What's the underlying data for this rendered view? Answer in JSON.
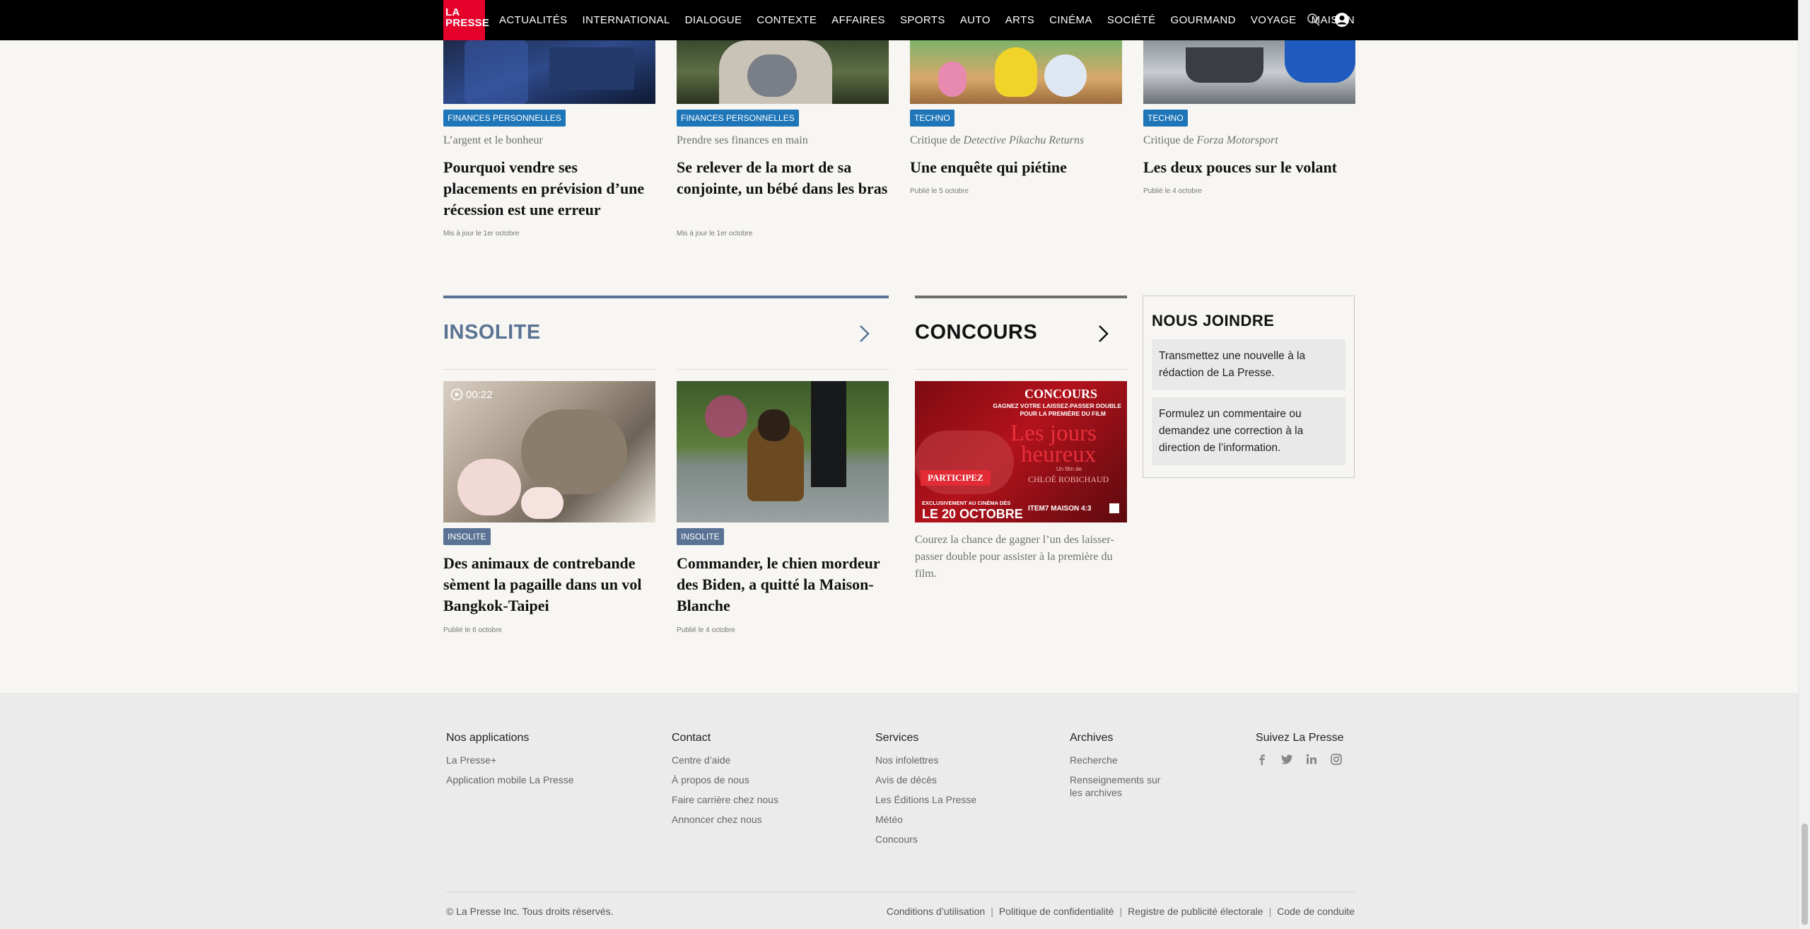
{
  "logo": {
    "line1": "LA",
    "line2": "PRESSE"
  },
  "nav": [
    "ACTUALITÉS",
    "INTERNATIONAL",
    "DIALOGUE",
    "CONTEXTE",
    "AFFAIRES",
    "SPORTS",
    "AUTO",
    "ARTS",
    "CINÉMA",
    "SOCIÉTÉ",
    "GOURMAND",
    "VOYAGE",
    "MAISON"
  ],
  "top_cards": [
    {
      "tag": "FINANCES PERSONNELLES",
      "kicker": "L’argent et le bonheur",
      "headline": "Pourquoi vendre ses placements en prévision d’une récession est une erreur",
      "date": "Mis à jour le 1er octobre"
    },
    {
      "tag": "FINANCES PERSONNELLES",
      "kicker": "Prendre ses finances en main",
      "headline": "Se relever de la mort de sa conjointe, un bébé dans les bras",
      "date": "Mis à jour le 1er octobre"
    },
    {
      "tag": "TECHNO",
      "kicker_prefix": "Critique de ",
      "kicker_italic": "Detective Pikachu Returns",
      "headline": "Une enquête qui piétine",
      "date": "Publié le 5 octobre"
    },
    {
      "tag": "TECHNO",
      "kicker_prefix": "Critique de ",
      "kicker_italic": "Forza Motorsport",
      "headline": "Les deux pouces sur le volant",
      "date": "Publié le 4 octobre"
    }
  ],
  "insolite": {
    "title": "INSOLITE",
    "cards": [
      {
        "video_duration": "00:22",
        "tag": "INSOLITE",
        "headline": "Des animaux de contrebande sèment la pagaille dans un vol Bangkok-Taipei",
        "date": "Publié le 6 octobre"
      },
      {
        "tag": "INSOLITE",
        "headline": "Commander, le chien mordeur des Biden, a quitté la Maison-Blanche",
        "date": "Publié le 4 octobre"
      }
    ]
  },
  "concours": {
    "title": "CONCOURS",
    "banner": {
      "heading": "CONCOURS",
      "sub1": "GAGNEZ VOTRE LAISSEZ-PASSER DOUBLE",
      "sub2": "POUR LA PREMIÈRE DU FILM",
      "film_line1": "Les jours",
      "film_line2": "heureux",
      "director_small": "Un film de",
      "director": "CHLOÉ ROBICHAUD",
      "cta": "PARTICIPEZ",
      "excl": "EXCLUSIVEMENT AU CINÉMA DÈS",
      "date": "LE 20 OCTOBRE",
      "logos": "ITEM7   MAISON 4:3"
    },
    "description": "Courez la chance de gagner l’un des laisser-passer double pour assister à la première du film."
  },
  "joindre": {
    "title": "NOUS JOINDRE",
    "box1": "Transmettez une nouvelle à la rédaction de La Presse.",
    "box2": "Formulez un commentaire ou demandez une correction à la direction de l’information."
  },
  "footer": {
    "apps": {
      "title": "Nos applications",
      "links": [
        "La Presse+",
        "Application mobile La Presse"
      ]
    },
    "contact": {
      "title": "Contact",
      "links": [
        "Centre d’aide",
        "À propos de nous",
        "Faire carrière chez nous",
        "Annoncer chez nous"
      ]
    },
    "services": {
      "title": "Services",
      "links": [
        "Nos infolettres",
        "Avis de décès",
        "Les Éditions La Presse",
        "Météo",
        "Concours"
      ]
    },
    "archives": {
      "title": "Archives",
      "links": [
        "Recherche",
        "Renseignements sur",
        "les archives"
      ]
    },
    "social": {
      "title": "Suivez La Presse",
      "icons": [
        "facebook-icon",
        "twitter-icon",
        "linkedin-icon",
        "instagram-icon"
      ]
    },
    "copyright": "© La Presse Inc. Tous droits réservés.",
    "legal": [
      "Conditions d’utilisation",
      "Politique de confidentialité",
      "Registre de publicité électorale",
      "Code de conduite"
    ]
  },
  "colors": {
    "brand_red": "#e4002b",
    "tag_blue": "#1e76b8",
    "insolite_slate": "#5a7394"
  }
}
